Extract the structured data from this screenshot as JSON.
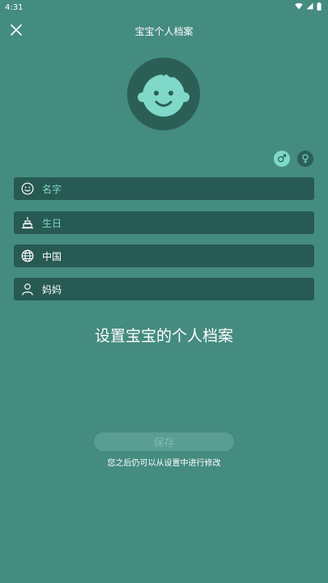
{
  "status_bar": {
    "time": "4:31"
  },
  "app_bar": {
    "title": "宝宝个人档案"
  },
  "gender": {
    "male_symbol": "♂",
    "female_symbol": "♀",
    "selected": "male"
  },
  "fields": [
    {
      "icon": "smiley-icon",
      "placeholder": "名字",
      "value": ""
    },
    {
      "icon": "birthday-cake-icon",
      "placeholder": "生日",
      "value": ""
    },
    {
      "icon": "globe-icon",
      "placeholder": "",
      "value": "中国"
    },
    {
      "icon": "person-icon",
      "placeholder": "",
      "value": "妈妈"
    }
  ],
  "headline": "设置宝宝的个人档案",
  "save_label": "保存",
  "hint": "您之后仍可以从设置中进行修改",
  "colors": {
    "background": "#448b80",
    "field_background": "#275a52",
    "accent": "#7fd8c8",
    "avatar_background": "#2b5f56"
  }
}
